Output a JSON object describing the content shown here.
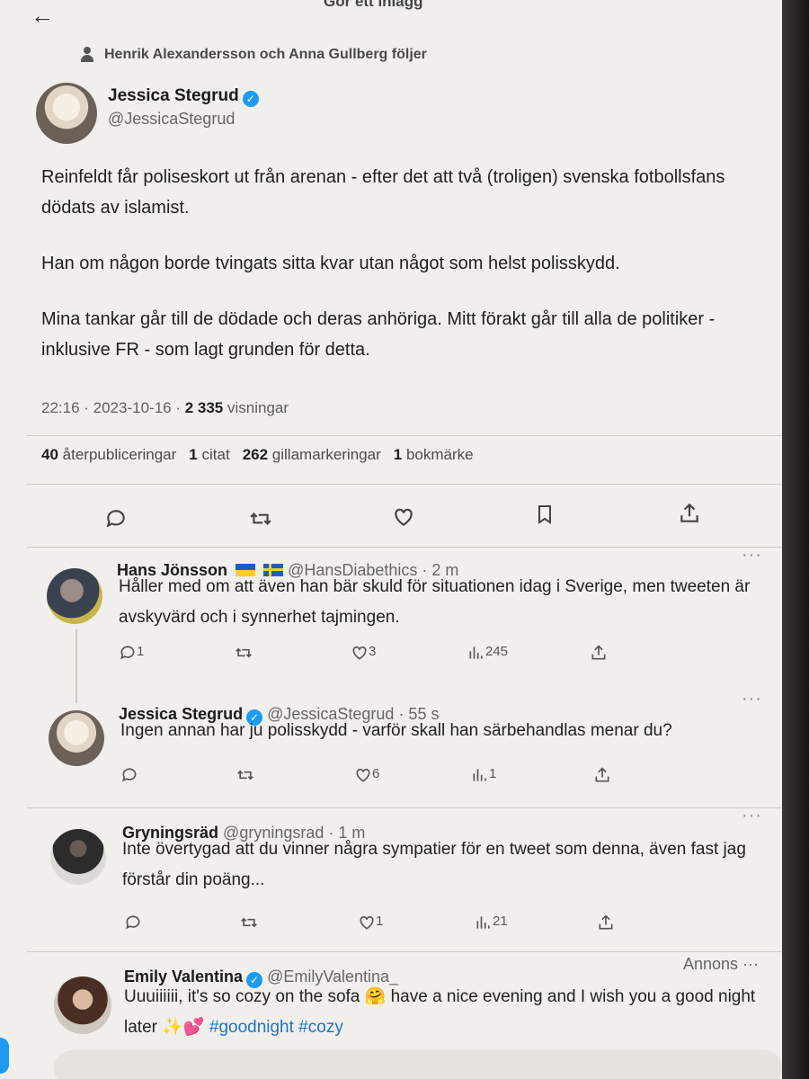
{
  "topbar": {
    "back_icon": "←",
    "title": "Gör ett inlägg"
  },
  "social_context": "Henrik Alexandersson och Anna Gullberg följer",
  "main_tweet": {
    "name": "Jessica Stegrud",
    "handle": "@JessicaStegrud",
    "paragraphs": [
      "Reinfeldt får poliseskort ut från arenan - efter det att två (troligen) svenska fotbollsfans dödats av islamist.",
      "Han om någon borde tvingats sitta kvar utan något som helst polisskydd.",
      "Mina tankar går till de dödade och deras anhöriga. Mitt förakt går till alla de politiker - inklusive FR - som lagt grunden för detta."
    ],
    "time": "22:16 · 2023-10-16 · ",
    "views_count": "2 335",
    "views_label": " visningar",
    "stats": [
      {
        "count": "40",
        "label": "återpubliceringar"
      },
      {
        "count": "1",
        "label": "citat"
      },
      {
        "count": "262",
        "label": "gillamarkeringar"
      },
      {
        "count": "1",
        "label": "bokmärke"
      }
    ]
  },
  "replies": [
    {
      "name": "Hans Jönsson",
      "handle": "@HansDiabethics",
      "time": " · 2 m",
      "text": "Håller med om att även han bär skuld för situationen idag i Sverige, men tweeten är avskyvärd och i synnerhet tajmingen.",
      "replies": "1",
      "reposts": "",
      "likes": "3",
      "views": "245"
    },
    {
      "name": "Jessica Stegrud",
      "handle": "@JessicaStegrud",
      "time": " · 55 s",
      "text": "Ingen annan har ju polisskydd - varför skall han särbehandlas menar du?",
      "replies": "",
      "reposts": "",
      "likes": "6",
      "views": "1"
    },
    {
      "name": "Gryningsräd",
      "handle": "@gryningsrad",
      "time": " · 1 m",
      "text": "Inte övertygad att du vinner några sympatier för en tweet som denna, även fast jag förstår din poäng...",
      "replies": "",
      "reposts": "",
      "likes": "1",
      "views": "21"
    }
  ],
  "ad": {
    "label": "Annons",
    "name": "Emily Valentina",
    "handle": "@EmilyValentina_",
    "text_start": "Uuuiiiiii, it's so cozy on the sofa ",
    "emoji_1": "🤗",
    "text_mid": " have a nice evening and I wish you a good night later ",
    "emoji_2": "✨",
    "emoji_3": "💕",
    "hashtags": " #goodnight #cozy"
  },
  "more_icon": "···",
  "colors": {
    "verified": "#1d9bf0",
    "hashtag": "#1d72c9",
    "background": "#f1efec"
  }
}
